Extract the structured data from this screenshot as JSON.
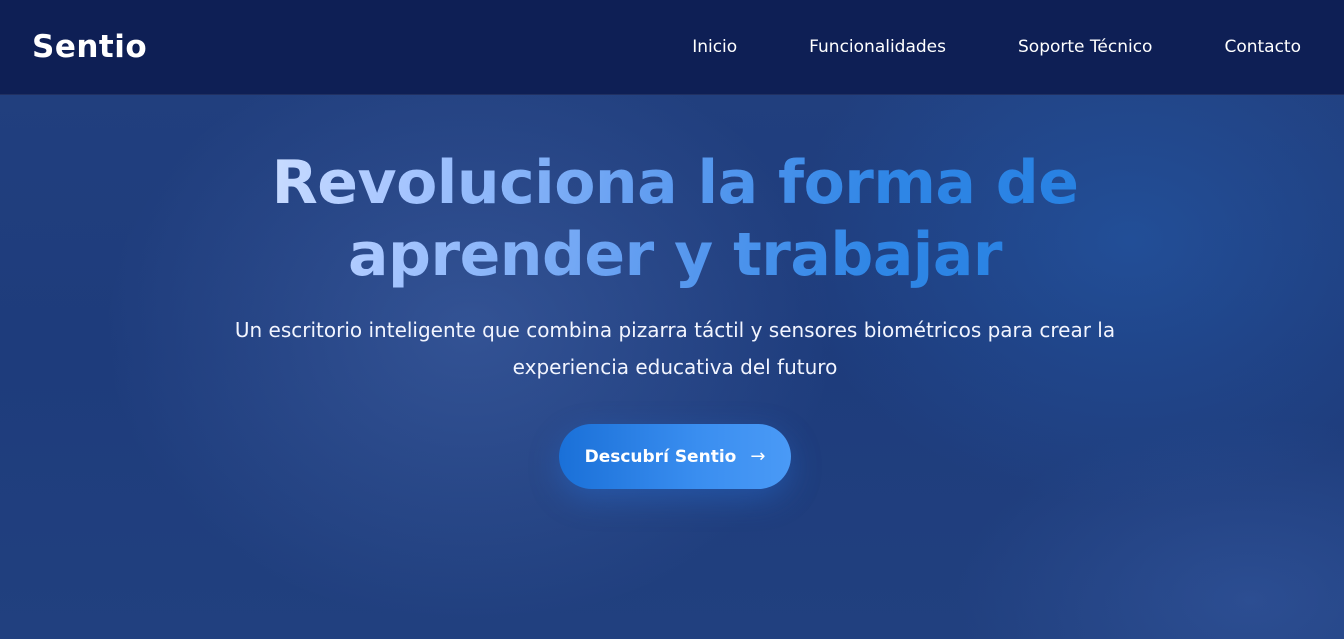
{
  "navbar": {
    "logo": "Sentio",
    "links": [
      {
        "label": "Inicio"
      },
      {
        "label": "Funcionalidades"
      },
      {
        "label": "Soporte Técnico"
      },
      {
        "label": "Contacto"
      }
    ]
  },
  "hero": {
    "title": "Revoluciona la forma de aprender y trabajar",
    "subtitle": "Un escritorio inteligente que combina pizarra táctil y sensores biométricos para crear la experiencia educativa del futuro",
    "cta": {
      "label": "Descubrí Sentio",
      "icon": "arrow-right-icon",
      "icon_glyph": "→"
    }
  },
  "colors": {
    "navbar_bg": "#0e1f55",
    "page_bg": "#1f3d7d",
    "accent": "#2f86e6",
    "button_start": "#1a70d8",
    "button_end": "#4a9af6"
  }
}
